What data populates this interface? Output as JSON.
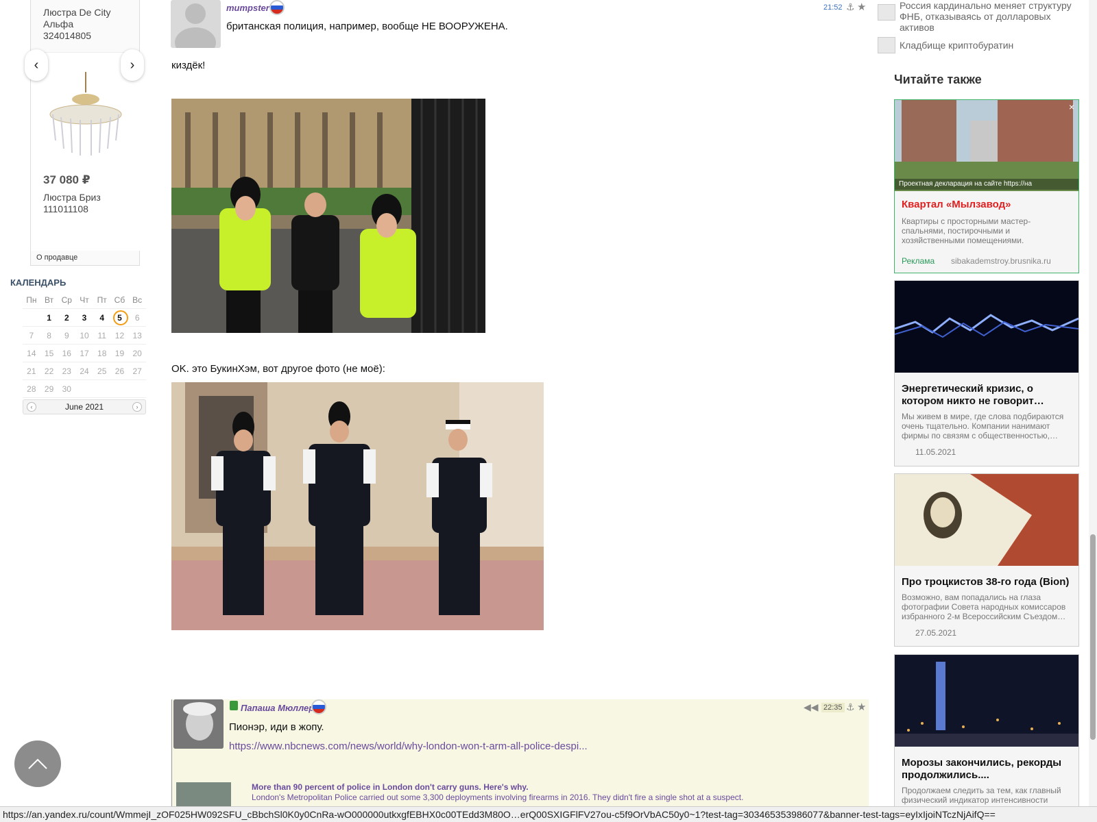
{
  "shop": {
    "product1_name": "Люстра De City Альфа",
    "product1_code": "324014805",
    "product2_price": "37 080 ₽",
    "product2_name": "Люстра Бриз",
    "product2_code": "111011108",
    "seller_label": "О продавце"
  },
  "calendar": {
    "title": "КАЛЕНДАРЬ",
    "days": [
      "Пн",
      "Вт",
      "Ср",
      "Чт",
      "Пт",
      "Сб",
      "Вс"
    ],
    "weeks": [
      [
        "",
        "1",
        "2",
        "3",
        "4",
        "5",
        "6"
      ],
      [
        "7",
        "8",
        "9",
        "10",
        "11",
        "12",
        "13"
      ],
      [
        "14",
        "15",
        "16",
        "17",
        "18",
        "19",
        "20"
      ],
      [
        "21",
        "22",
        "23",
        "24",
        "25",
        "26",
        "27"
      ],
      [
        "28",
        "29",
        "30",
        "",
        "",
        "",
        ""
      ]
    ],
    "month_label": "June 2021"
  },
  "comment1": {
    "author": "mumpster",
    "time": "21:52",
    "text": "британская полиция, например, вообще НЕ ВООРУЖЕНА."
  },
  "post": {
    "line1": "киздёк!",
    "line2": "OK. это БукинХэм, вот другое фото (не моё):"
  },
  "comment2": {
    "author": "Папаша Мюллер",
    "time": "22:35",
    "text": "Пионэр, иди в жопу.",
    "link": "https://www.nbcnews.com/news/world/why-london-won-t-arm-all-police-despi...",
    "preview_title": "More than 90 percent of police in London don't carry guns. Here's why.",
    "preview_desc": "London's Metropolitan Police carried out some 3,300 deployments involving firearms in 2016. They didn't fire a single shot at a suspect."
  },
  "news": [
    {
      "text": "Россия кардинально меняет структуру ФНБ, отказываясь от долларовых активов"
    },
    {
      "text": "Кладбище криптобуратин"
    }
  ],
  "read_also": "Читайте также",
  "ad": {
    "caption": "Проектная декларация на сайте https://на",
    "title": "Квартал «Мылзавод»",
    "desc": "Квартиры с просторными мастер-спальнями, постирочными и хозяйственными помещениями.",
    "label": "Реклама",
    "domain": "sibakademstroy.brusnika.ru"
  },
  "cards": [
    {
      "title": "Энергетический кризис, о котором никто не говорит…",
      "desc": "Мы живем в мире, где слова подбираются очень тщательно. Компании нанимают фирмы по связям с общественностью,…",
      "date": "11.05.2021"
    },
    {
      "title": "Про троцкистов 38-го года (Bion)",
      "desc": "Возможно, вам попадались на глаза фотографии Совета народных комиссаров избранного 2-м Всероссийским Съездом…",
      "date": "27.05.2021"
    },
    {
      "title": "Морозы закончились, рекорды продолжились....",
      "desc": "Продолжаем следить за тем, как главный физический индикатор интенсивности хозяйственной жизни страны, уровень..."
    }
  ],
  "status_url": "https://an.yandex.ru/count/WmmejI_zOF025HW092SFU_cBbchSl0K0y0CnRa-wO000000utkxgfEBHX0c00TEdd3M80O…erQ00SXIGFlFV27ou-c5f9OrVbAC50y0~1?test-tag=303465353986077&banner-test-tags=eyIxIjoiNTczNjAifQ=="
}
